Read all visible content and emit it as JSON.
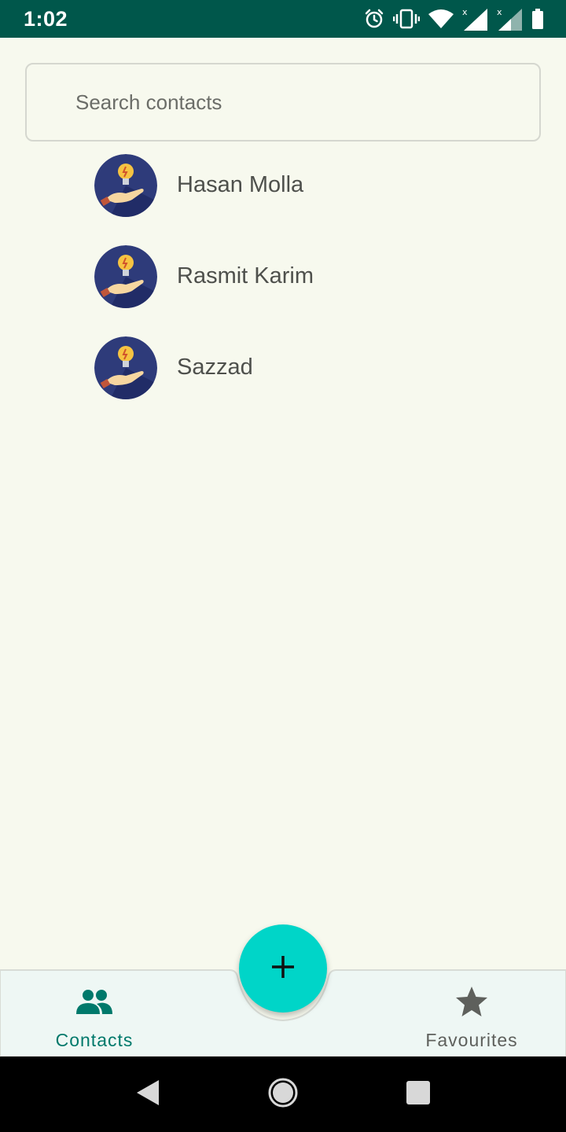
{
  "status_bar": {
    "time": "1:02",
    "icons": [
      "alarm-icon",
      "vibrate-icon",
      "wifi-icon",
      "signal-icon",
      "signal-icon",
      "battery-icon"
    ],
    "background": "#00574b"
  },
  "search": {
    "placeholder": "Search contacts",
    "value": ""
  },
  "contacts": [
    {
      "name": "Hasan Molla",
      "avatar": "lightbulb-hand-icon"
    },
    {
      "name": "Rasmit Karim",
      "avatar": "lightbulb-hand-icon"
    },
    {
      "name": "Sazzad",
      "avatar": "lightbulb-hand-icon"
    }
  ],
  "fab": {
    "icon": "plus-icon",
    "color": "#00d5c8"
  },
  "bottom_nav": {
    "items": [
      {
        "label": "Contacts",
        "icon": "people-icon",
        "active": true
      },
      {
        "label": "Favourites",
        "icon": "star-icon",
        "active": false
      }
    ],
    "active_color": "#00796b",
    "background": "#eef7f4"
  },
  "system_nav": {
    "buttons": [
      "back-icon",
      "home-icon",
      "recents-icon"
    ]
  }
}
